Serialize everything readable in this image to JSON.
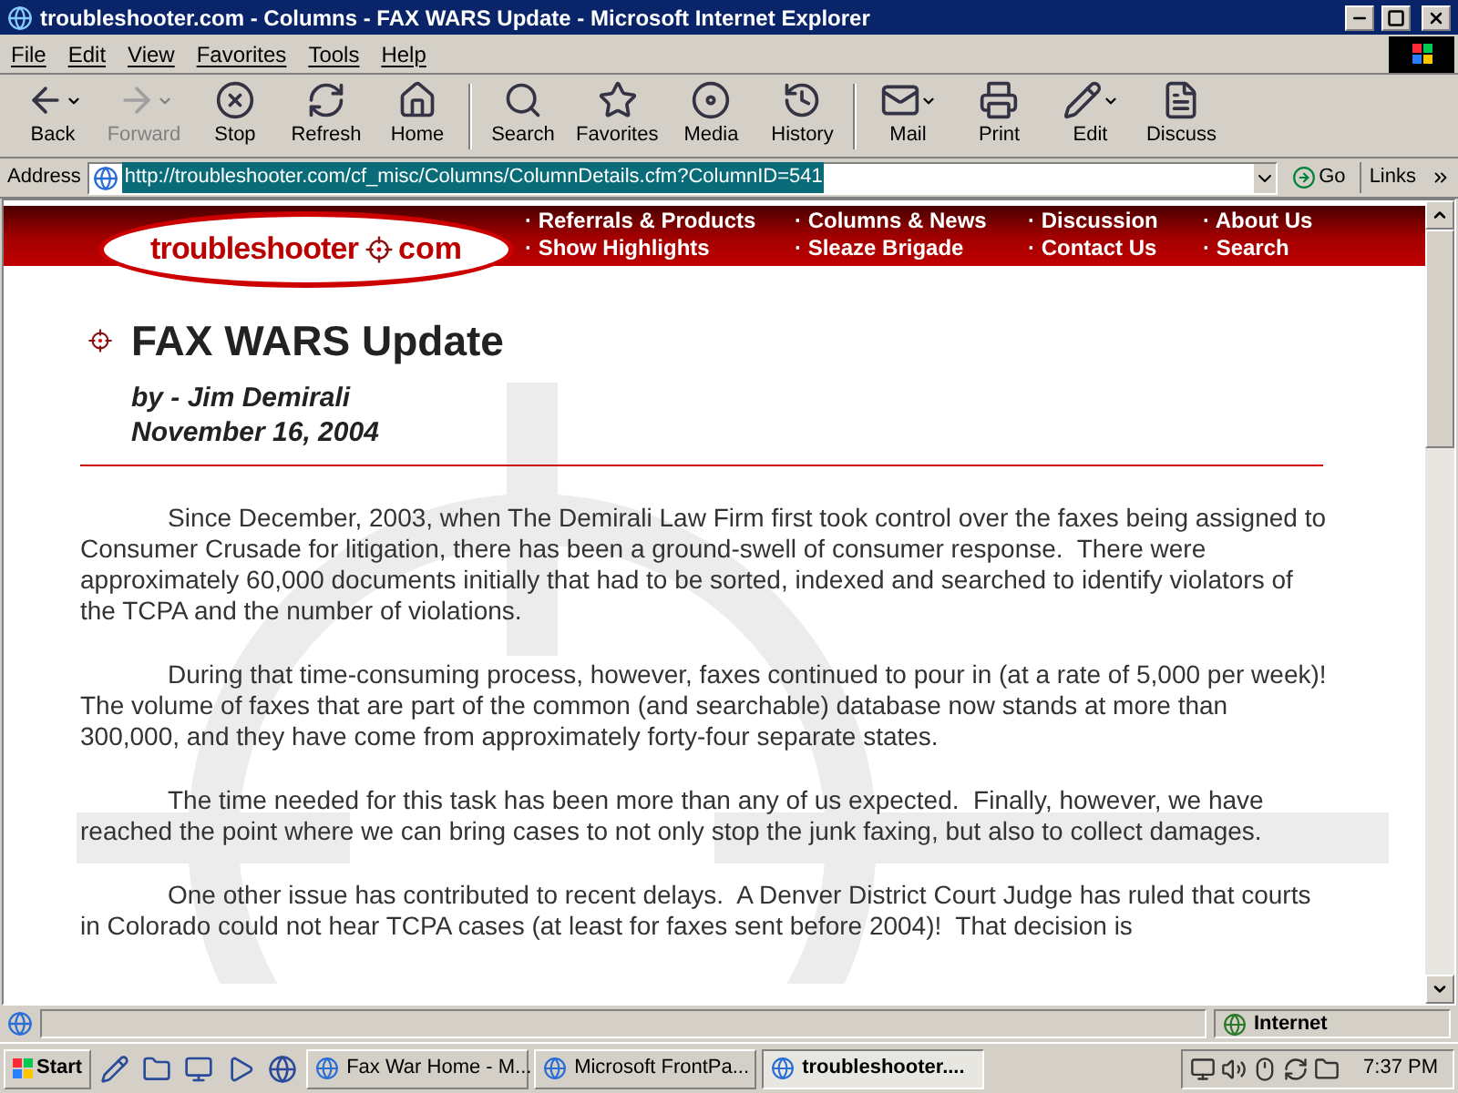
{
  "window": {
    "title": "troubleshooter.com - Columns - FAX WARS Update - Microsoft Internet Explorer"
  },
  "menu": [
    "File",
    "Edit",
    "View",
    "Favorites",
    "Tools",
    "Help"
  ],
  "toolbar": [
    {
      "label": "Back",
      "disabled": false,
      "dropdown": true
    },
    {
      "label": "Forward",
      "disabled": true,
      "dropdown": true
    },
    {
      "label": "Stop",
      "disabled": false,
      "dropdown": false
    },
    {
      "label": "Refresh",
      "disabled": false,
      "dropdown": false
    },
    {
      "label": "Home",
      "disabled": false,
      "dropdown": false
    },
    {
      "label": "Search",
      "disabled": false,
      "dropdown": false
    },
    {
      "label": "Favorites",
      "disabled": false,
      "dropdown": false
    },
    {
      "label": "Media",
      "disabled": false,
      "dropdown": false
    },
    {
      "label": "History",
      "disabled": false,
      "dropdown": false
    },
    {
      "label": "Mail",
      "disabled": false,
      "dropdown": true
    },
    {
      "label": "Print",
      "disabled": false,
      "dropdown": false
    },
    {
      "label": "Edit",
      "disabled": false,
      "dropdown": true
    },
    {
      "label": "Discuss",
      "disabled": false,
      "dropdown": false
    }
  ],
  "address_bar": {
    "label": "Address",
    "value": "http://troubleshooter.com/cf_misc/Columns/ColumnDetails.cfm?ColumnID=541",
    "go": "Go",
    "links": "Links"
  },
  "site": {
    "logo_left": "troubleshooter",
    "logo_right": "com",
    "nav": [
      [
        "· Referrals & Products",
        "· Show Highlights"
      ],
      [
        "· Columns & News",
        "· Sleaze Brigade"
      ],
      [
        "· Discussion",
        "· Contact Us"
      ],
      [
        "· About Us",
        "· Search"
      ]
    ]
  },
  "article": {
    "title": "FAX WARS Update",
    "byline": "by - Jim Demirali",
    "date": "November 16, 2004",
    "paragraphs": [
      "Since December, 2003, when The Demirali Law Firm first took control over the faxes being assigned to Consumer Crusade for litigation, there has been a ground-swell of consumer response.  There were approximately 60,000 documents initially that had to be sorted, indexed and searched to identify violators of the TCPA and the number of violations.",
      "During that time-consuming process, however, faxes continued to pour in (at a rate of 5,000 per week)!   The volume of faxes that are part of the common (and searchable) database now stands at more than 300,000, and they have come from approximately forty-four separate states.",
      "The time needed for this task has been more than any of us expected.  Finally, however, we have reached the point where we can bring cases to not only stop the junk faxing, but also to collect damages.",
      "One other issue has contributed to recent delays.  A Denver District Court Judge has ruled that courts in Colorado could not hear TCPA cases (at least for faxes sent before 2004)!  That decision is"
    ]
  },
  "status_bar": {
    "zone": "Internet"
  },
  "taskbar": {
    "start": "Start",
    "tasks": [
      {
        "label": "Fax War Home - M...",
        "selected": false
      },
      {
        "label": "Microsoft FrontPa...",
        "selected": false
      },
      {
        "label": "troubleshooter....",
        "selected": true
      }
    ],
    "clock": "7:37 PM"
  }
}
